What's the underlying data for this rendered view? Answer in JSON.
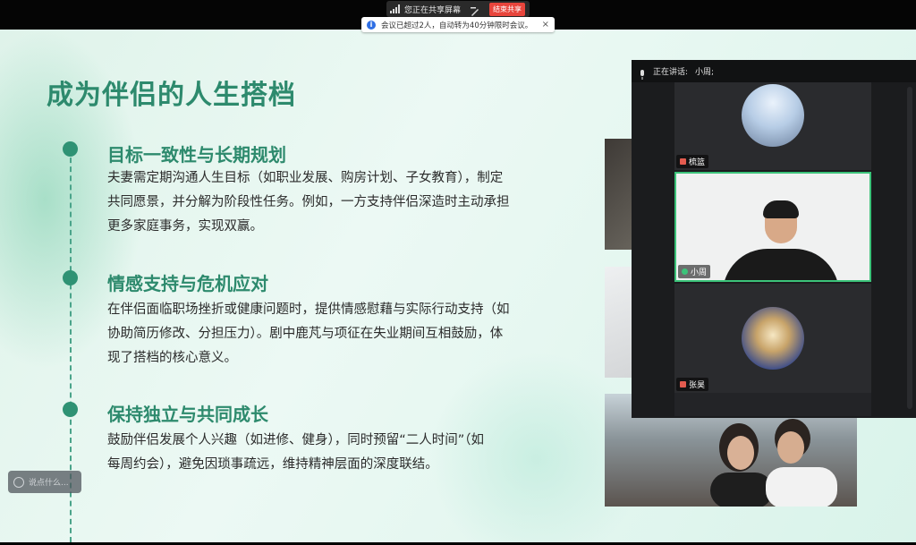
{
  "top_bar": {
    "sharing_status": "您正在共享屏幕",
    "stop_share_label": "结束共享",
    "notice_text": "会议已超过2人，自动转为40分钟限时会议。",
    "notice_close": "×"
  },
  "slide": {
    "title": "成为伴侣的人生搭档",
    "sections": [
      {
        "heading": "目标一致性与长期规划",
        "lines": [
          "夫妻需定期沟通人生目标（如职业发展、购房计划、子女教育），制定",
          "共同愿景，并分解为阶段性任务。例如，一方支持伴侣深造时主动承担",
          "更多家庭事务，实现双赢。"
        ]
      },
      {
        "heading": "情感支持与危机应对",
        "lines": [
          "在伴侣面临职场挫折或健康问题时，提供情感慰藉与实际行动支持（如",
          "协助简历修改、分担压力）。剧中鹿芃与项征在失业期间互相鼓励，体",
          "现了搭档的核心意义。"
        ]
      },
      {
        "heading": "保持独立与共同成长",
        "lines": [
          "鼓励伴侣发展个人兴趣（如进修、健身），同时预留“二人时间”（如",
          "每周约会），避免因琐事疏远，维持精神层面的深度联结。"
        ]
      }
    ]
  },
  "video_panel": {
    "speaking_label": "正在讲话:",
    "speaking_name": "小周;",
    "participants": [
      {
        "name": "梳篮",
        "muted": true
      },
      {
        "name": "小周",
        "muted": false
      },
      {
        "name": "张昊",
        "muted": true
      }
    ]
  },
  "chat_input": {
    "placeholder": "说点什么..."
  },
  "colors": {
    "accent": "#2d8a6d",
    "speaker_border": "#3cc37a",
    "stop_button": "#e8453c"
  }
}
